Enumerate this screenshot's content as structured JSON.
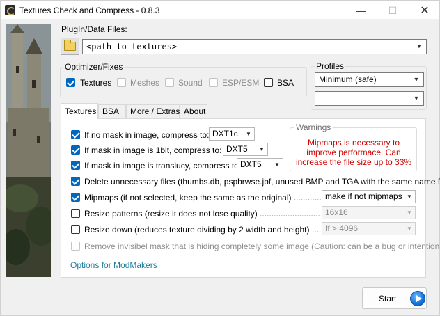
{
  "window": {
    "title": "Textures Check and Compress - 0.8.3",
    "min_glyph": "—",
    "max_glyph": "☐",
    "close_glyph": "✕"
  },
  "plugin": {
    "label": "PlugIn/Data Files:",
    "path_value": "<path to textures>",
    "folder_icon": "folder-icon"
  },
  "optimizer": {
    "label": "Optimizer/Fixes",
    "items": [
      {
        "label": "Textures",
        "checked": true,
        "enabled": true
      },
      {
        "label": "Meshes",
        "checked": false,
        "enabled": false
      },
      {
        "label": "Sound",
        "checked": false,
        "enabled": false
      },
      {
        "label": "ESP/ESM",
        "checked": false,
        "enabled": false
      },
      {
        "label": "BSA",
        "checked": false,
        "enabled": true
      }
    ]
  },
  "profiles": {
    "label": "Profiles",
    "selected": "Minimum (safe)",
    "second_value": ""
  },
  "tabs": [
    {
      "label": "Textures",
      "active": true
    },
    {
      "label": "BSA",
      "active": false
    },
    {
      "label": "More / Extras",
      "active": false
    },
    {
      "label": "About",
      "active": false
    }
  ],
  "options": {
    "no_mask": {
      "label": "If no mask in image, compress to:",
      "value": "DXT1c",
      "checked": true
    },
    "mask_1bit": {
      "label": "If mask in image is 1bit, compress to:",
      "value": "DXT5",
      "checked": true
    },
    "mask_translucy": {
      "label": "If mask in image is translucy, compress to:",
      "value": "DXT5",
      "checked": true
    },
    "delete_files": {
      "label": "Delete unnecessary files (thumbs.db, pspbrwse.jbf, unused BMP and TGA with the same name DDS).",
      "checked": true
    },
    "mipmaps": {
      "label": "Mipmaps (if not selected, keep the same as the original) .........................",
      "value": "make if not mipmaps",
      "checked": true
    },
    "resize_patterns": {
      "label": "Resize patterns (resize it does not lose quality) ...............................................",
      "value": "16x16",
      "checked": false
    },
    "resize_down": {
      "label": "Resize down (reduces texture dividing by 2 width and height) ..................",
      "value": "If > 4096",
      "checked": false
    },
    "remove_mask": {
      "label": "Remove invisibel mask that is hiding completely some image (Caution: can be a bug or intentional)",
      "checked": false,
      "enabled": false
    }
  },
  "warnings": {
    "label": "Warnings",
    "text": "Mipmaps is necessary to improve performace. Can increase the file size up to 33%",
    "color": "#d40000"
  },
  "link": {
    "label": "Options for ModMakers",
    "color": "#1e7d9a"
  },
  "start": {
    "label": "Start",
    "icon": "play-icon"
  },
  "colors": {
    "accent": "#0067c0"
  }
}
